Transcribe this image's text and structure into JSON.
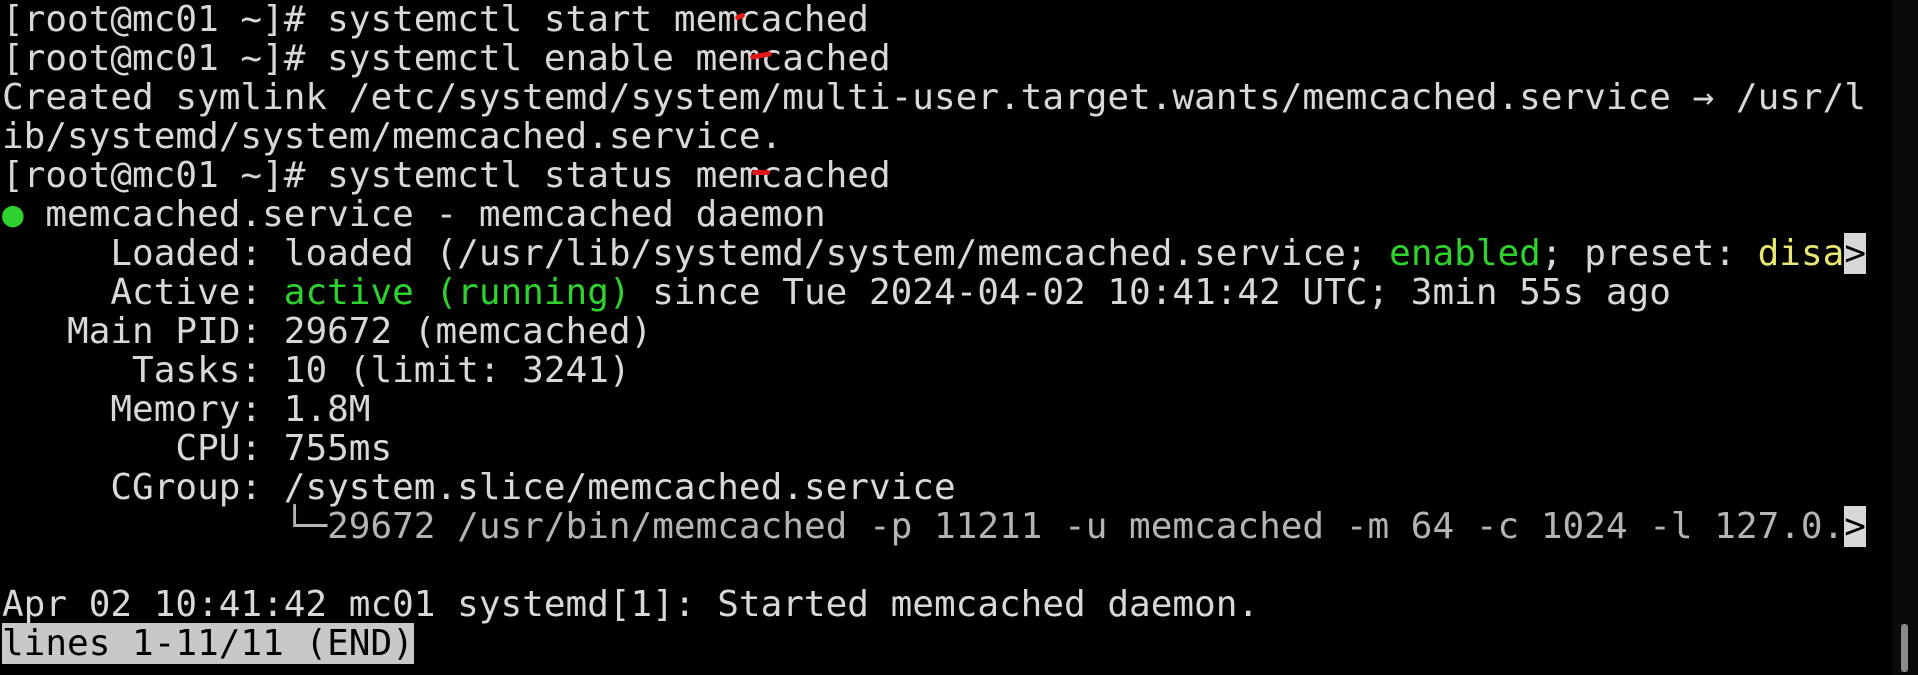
{
  "terminal": {
    "line1": {
      "prompt": "[root@mc01 ~]# ",
      "command": "systemctl start memcached"
    },
    "line2": {
      "prompt": "[root@mc01 ~]# ",
      "command": "systemctl enable memcached"
    },
    "line3": "Created symlink /etc/systemd/system/multi-user.target.wants/memcached.service → /usr/l",
    "line4": "ib/systemd/system/memcached.service.",
    "line5": {
      "prompt": "[root@mc01 ~]# ",
      "command": "systemctl status memcached"
    },
    "service": {
      "dot": "●",
      "header": " memcached.service - memcached daemon",
      "loaded": {
        "label": "     Loaded: ",
        "pre": "loaded (/usr/lib/systemd/system/memcached.service; ",
        "enabled": "enabled",
        "mid": "; preset: ",
        "preset": "disa",
        "truncated": ">"
      },
      "active": {
        "label": "     Active: ",
        "state": "active (running)",
        "since": " since Tue 2024-04-02 10:41:42 UTC; 3min 55s ago"
      },
      "mainpid": {
        "label": "   Main PID: ",
        "value": "29672 (memcached)"
      },
      "tasks": {
        "label": "      Tasks: ",
        "value": "10 (limit: 3241)"
      },
      "memory": {
        "label": "     Memory: ",
        "value": "1.8M"
      },
      "cpu": {
        "label": "        CPU: ",
        "value": "755ms"
      },
      "cgroup": {
        "label": "     CGroup: ",
        "value": "/system.slice/memcached.service"
      },
      "process": {
        "indent": "             ",
        "text": "└─29672 /usr/bin/memcached -p 11211 -u memcached -m 64 -c 1024 -l 127.0.",
        "truncated": ">"
      }
    },
    "log_line": "Apr 02 10:41:42 mc01 systemd[1]: Started memcached daemon.",
    "pager_status": "lines 1-11/11 (END)"
  },
  "colors": {
    "background": "#000000",
    "text": "#d8d8d8",
    "active_green": "#2ed12e",
    "preset_yellow": "#e6e675",
    "annotation_red": "#e01818"
  }
}
